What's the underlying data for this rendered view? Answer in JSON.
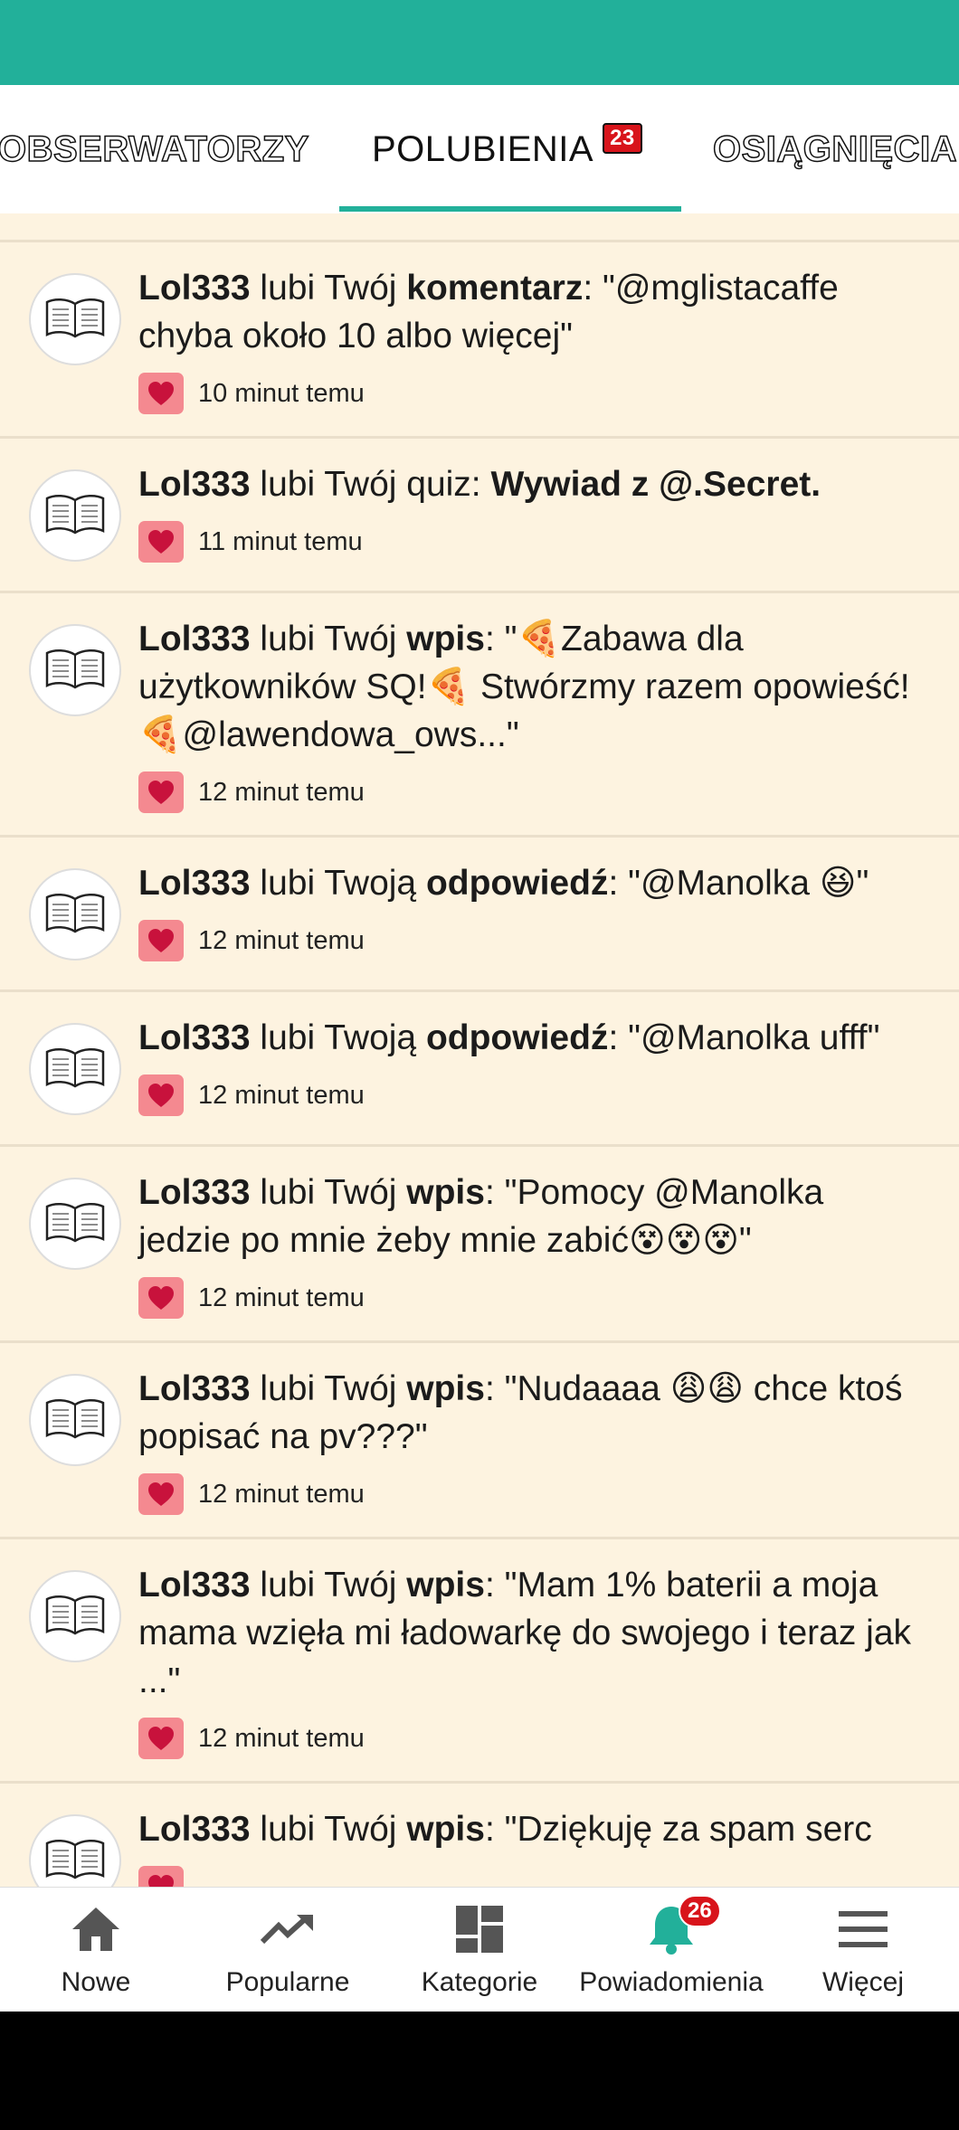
{
  "tabs": [
    {
      "label": "OBSERWATORZY"
    },
    {
      "label": "POLUBIENIA",
      "badge": "23"
    },
    {
      "label": "OSIĄGNIĘCIA"
    }
  ],
  "notifications": [
    {
      "user": "Lol333",
      "verb": " lubi Twój ",
      "object": "komentarz",
      "quote": ": \"@mglistacaffe chyba około 10 albo więcej\"",
      "time": "10 minut temu"
    },
    {
      "user": "Lol333",
      "verb": " lubi Twój quiz: ",
      "object": "Wywiad z @.Secret.",
      "quote": "",
      "time": "11 minut temu"
    },
    {
      "user": "Lol333",
      "verb": " lubi Twój ",
      "object": "wpis",
      "quote": ": \"🍕Zabawa dla użytkowników SQ!🍕 Stwórzmy razem opowieść! 🍕@lawendowa_ows...\"",
      "time": "12 minut temu"
    },
    {
      "user": "Lol333",
      "verb": " lubi Twoją ",
      "object": "odpowiedź",
      "quote": ": \"@Manolka 😆\"",
      "time": "12 minut temu"
    },
    {
      "user": "Lol333",
      "verb": " lubi Twoją ",
      "object": "odpowiedź",
      "quote": ": \"@Manolka ufff\"",
      "time": "12 minut temu"
    },
    {
      "user": "Lol333",
      "verb": " lubi Twój ",
      "object": "wpis",
      "quote": ": \"Pomocy @Manolka jedzie po mnie żeby mnie zabić😵😵😵\"",
      "time": "12 minut temu"
    },
    {
      "user": "Lol333",
      "verb": " lubi Twój ",
      "object": "wpis",
      "quote": ": \"Nudaaaa 😩😩 chce ktoś popisać na pv???\"",
      "time": "12 minut temu"
    },
    {
      "user": "Lol333",
      "verb": " lubi Twój ",
      "object": "wpis",
      "quote": ": \"Mam 1% baterii a moja mama wzięła mi ładowarkę do swojego i teraz jak ...\"",
      "time": "12 minut temu"
    },
    {
      "user": "Lol333",
      "verb": " lubi Twój ",
      "object": "wpis",
      "quote": ": \"Dziękuję za spam serc",
      "time": ""
    }
  ],
  "bottom_nav": [
    {
      "label": "Nowe",
      "icon": "home-icon"
    },
    {
      "label": "Popularne",
      "icon": "trending-icon"
    },
    {
      "label": "Kategorie",
      "icon": "grid-icon"
    },
    {
      "label": "Powiadomienia",
      "icon": "bell-icon",
      "badge": "26"
    },
    {
      "label": "Więcej",
      "icon": "menu-icon"
    }
  ],
  "colors": {
    "accent": "#22b09a",
    "badge": "#d8141b",
    "heart": "#c8123c",
    "background": "#fdf3e0"
  }
}
